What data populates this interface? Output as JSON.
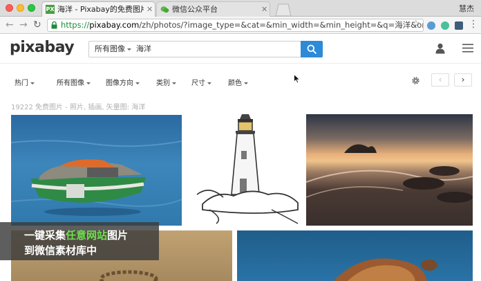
{
  "browser": {
    "tabs": [
      {
        "title": "海洋 - Pixabay的免费图片",
        "favicon": "PX"
      },
      {
        "title": "微信公众平台"
      }
    ],
    "user_name": "慧杰",
    "url_scheme": "https://",
    "url_host": "pixabay.com",
    "url_path": "/zh/photos/?image_type=&cat=&min_width=&min_height=&q=海洋&order=popular"
  },
  "header": {
    "logo": "pixabay",
    "search_type": "所有图像",
    "search_query": "海洋"
  },
  "filters": [
    "热门",
    "所有图像",
    "图像方向",
    "类别",
    "尺寸",
    "颜色"
  ],
  "pager": {
    "prev": "‹",
    "next": "›"
  },
  "result_summary": "19222 免费图片 - 照片, 插画, 矢量图: 海洋",
  "overlay": {
    "line1_a": "一键采集",
    "line1_highlight": "任意网站",
    "line1_b": "图片",
    "line2": "到微信素材库中"
  },
  "colors": {
    "accent": "#2c8ad8",
    "highlight": "#6be04d",
    "secure": "#1e8b3c"
  }
}
